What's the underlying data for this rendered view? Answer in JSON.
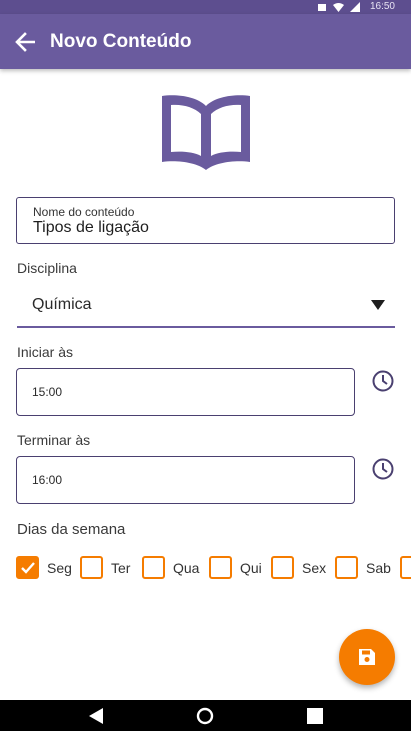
{
  "status_bar": {
    "time": "16:50",
    "icons": [
      "battery-icon",
      "wifi-icon",
      "signal-icon"
    ],
    "color": "#5d4e8f"
  },
  "app_bar": {
    "title": "Novo Conteúdo",
    "back_icon": "arrow-back-icon",
    "color": "#6a5b9e"
  },
  "header_icon": "open-book-icon",
  "form": {
    "content_name": {
      "label": "Nome do conteúdo",
      "value": "Tipos de ligação"
    },
    "subject": {
      "label": "Disciplina",
      "value": "Química"
    },
    "start": {
      "label": "Iniciar às",
      "value": "15:00"
    },
    "end": {
      "label": "Terminar às",
      "value": "16:00"
    },
    "days": {
      "label": "Dias da semana",
      "items": [
        {
          "label": "Seg",
          "checked": true
        },
        {
          "label": "Ter",
          "checked": false
        },
        {
          "label": "Qua",
          "checked": false
        },
        {
          "label": "Qui",
          "checked": false
        },
        {
          "label": "Sex",
          "checked": false
        },
        {
          "label": "Sab",
          "checked": false
        },
        {
          "label": "",
          "checked": false
        }
      ]
    }
  },
  "fab": {
    "icon": "save-icon",
    "color": "#f57c00"
  },
  "nav_bar": {
    "icons": [
      "back-triangle-icon",
      "home-circle-icon",
      "recents-square-icon"
    ]
  }
}
